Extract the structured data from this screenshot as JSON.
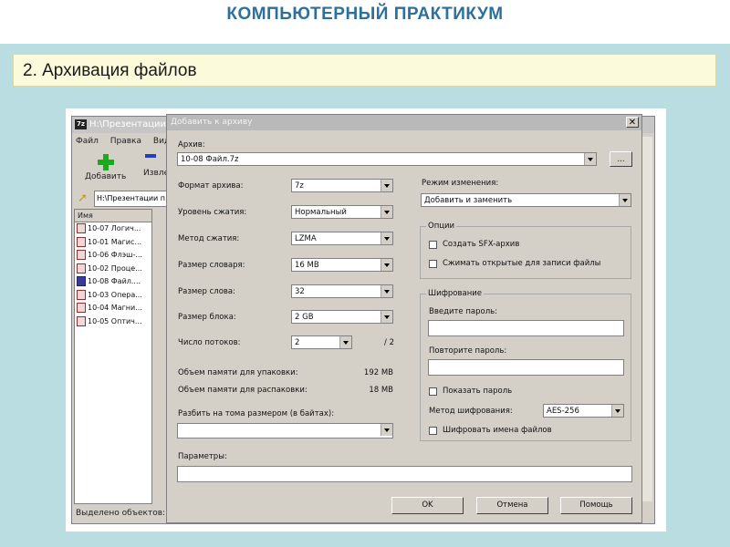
{
  "slide": {
    "title": "КОМПЬЮТЕРНЫЙ ПРАКТИКУМ",
    "subtitle": "2. Архивация файлов"
  },
  "back_window": {
    "title": "H:\\Презентации п",
    "menu": [
      "Файл",
      "Правка",
      "Вид"
    ],
    "toolbar": {
      "add_label": "Добавить",
      "extract_label": "Извле"
    },
    "address": "H:\\Презентации п",
    "list_header": "Имя",
    "files": [
      "10-07 Логич...",
      "10-01 Магис...",
      "10-06 Флэш-...",
      "10-02 Проце...",
      "10-08 Файл....",
      "10-03 Опера...",
      "10-04 Магни...",
      "10-05 Оптич..."
    ],
    "selected_index": 4,
    "status": "Выделено объектов: 1"
  },
  "dialog": {
    "title": "Добавить к архиву",
    "close_glyph": "✕",
    "archive_label": "Архив:",
    "archive_value": "10-08 Файл.7z",
    "browse_label": "...",
    "format_label": "Формат архива:",
    "format_value": "7z",
    "level_label": "Уровень сжатия:",
    "level_value": "Нормальный",
    "method_label": "Метод сжатия:",
    "method_value": "LZMA",
    "dict_label": "Размер словаря:",
    "dict_value": "16 MB",
    "word_label": "Размер слова:",
    "word_value": "32",
    "block_label": "Размер блока:",
    "block_value": "2 GB",
    "threads_label": "Число потоков:",
    "threads_value": "2",
    "threads_max": "/ 2",
    "mem_pack_label": "Объем памяти для упаковки:",
    "mem_pack_value": "192 MB",
    "mem_unpack_label": "Объем памяти для распаковки:",
    "mem_unpack_value": "18 MB",
    "split_label": "Разбить на тома размером (в байтах):",
    "split_value": "",
    "params_label": "Параметры:",
    "params_value": "",
    "update_mode_label": "Режим изменения:",
    "update_mode_value": "Добавить и заменить",
    "options": {
      "group_label": "Опции",
      "sfx_label": "Создать SFX-архив",
      "shared_label": "Сжимать открытые для записи файлы"
    },
    "encryption": {
      "group_label": "Шифрование",
      "password_label": "Введите пароль:",
      "password_value": "",
      "repeat_label": "Повторите пароль:",
      "repeat_value": "",
      "show_label": "Показать пароль",
      "method_label": "Метод шифрования:",
      "method_value": "AES-256",
      "names_label": "Шифровать имена файлов"
    },
    "buttons": {
      "ok": "OK",
      "cancel": "Отмена",
      "help": "Помощь"
    }
  }
}
